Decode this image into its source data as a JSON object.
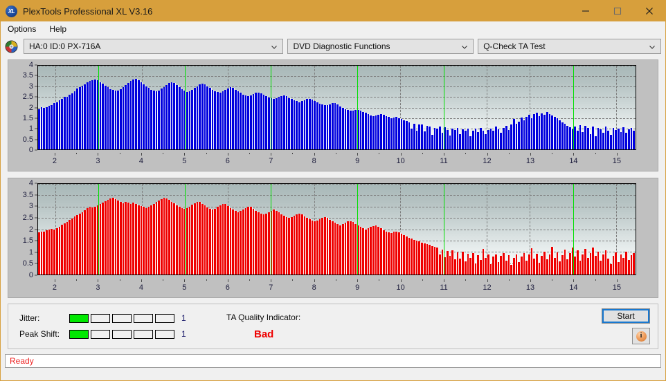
{
  "window": {
    "title": "PlexTools Professional XL V3.16",
    "icon": "xl-app-icon",
    "minimize_label": "minimize-icon",
    "maximize_label": "maximize-icon",
    "close_label": "close-icon"
  },
  "menu": {
    "items": [
      {
        "label": "Options"
      },
      {
        "label": "Help"
      }
    ]
  },
  "toolbar": {
    "drive_icon": "disc-icon",
    "drive_value": "HA:0 ID:0  PX-716A",
    "function_value": "DVD Diagnostic Functions",
    "test_value": "Q-Check TA Test",
    "chevron_icon": "chevron-down-icon"
  },
  "indicators": {
    "jitter": {
      "label": "Jitter:",
      "value": "1",
      "segments_total": 5,
      "segments_on": 1,
      "on_color": "#00e800"
    },
    "peak_shift": {
      "label": "Peak Shift:",
      "value": "1",
      "segments_total": 5,
      "segments_on": 1,
      "on_color": "#00e800"
    },
    "ta_quality": {
      "label": "TA Quality Indicator:",
      "value": "Bad",
      "value_color": "#ee0000"
    }
  },
  "actions": {
    "start_label": "Start",
    "info_label": "i",
    "info_icon": "info-icon"
  },
  "status": {
    "text": "Ready",
    "color": "#ee2222"
  },
  "chart_data": [
    {
      "id": "ta-jitter-chart",
      "type": "bar",
      "title": "",
      "xlabel": "",
      "ylabel": "",
      "bar_color": "#0000dd",
      "ylim": [
        0,
        4
      ],
      "yticks": [
        0,
        0.5,
        1,
        1.5,
        2,
        2.5,
        3,
        3.5,
        4
      ],
      "ytick_labels": [
        "0",
        "0.5",
        "1",
        "1.5",
        "2",
        "2.5",
        "3",
        "3.5",
        "4"
      ],
      "xlim": [
        1.6,
        15.45
      ],
      "xticks": [
        2,
        3,
        4,
        5,
        6,
        7,
        8,
        9,
        10,
        11,
        12,
        13,
        14,
        15
      ],
      "xtick_labels": [
        "2",
        "3",
        "4",
        "5",
        "6",
        "7",
        "8",
        "9",
        "10",
        "11",
        "12",
        "13",
        "14",
        "15"
      ],
      "grid": true,
      "markers": [
        3,
        5,
        7,
        9,
        11,
        14
      ],
      "marker_color": "#00e000",
      "values": [
        1.92,
        2.02,
        2.0,
        2.02,
        2.08,
        2.12,
        2.2,
        2.26,
        2.34,
        2.42,
        2.5,
        2.52,
        2.6,
        2.68,
        2.78,
        2.9,
        2.98,
        3.04,
        3.12,
        3.2,
        3.26,
        3.3,
        3.34,
        3.3,
        3.22,
        3.14,
        3.04,
        2.96,
        2.88,
        2.84,
        2.8,
        2.82,
        2.88,
        2.96,
        3.06,
        3.16,
        3.26,
        3.34,
        3.36,
        3.3,
        3.22,
        3.12,
        3.02,
        2.94,
        2.86,
        2.8,
        2.78,
        2.82,
        2.9,
        2.98,
        3.08,
        3.16,
        3.2,
        3.16,
        3.08,
        2.98,
        2.88,
        2.8,
        2.76,
        2.78,
        2.86,
        2.94,
        3.02,
        3.1,
        3.14,
        3.1,
        3.02,
        2.94,
        2.86,
        2.78,
        2.74,
        2.72,
        2.78,
        2.86,
        2.92,
        2.98,
        2.94,
        2.86,
        2.78,
        2.7,
        2.62,
        2.58,
        2.54,
        2.58,
        2.64,
        2.7,
        2.72,
        2.68,
        2.62,
        2.54,
        2.48,
        2.44,
        2.4,
        2.44,
        2.5,
        2.56,
        2.58,
        2.54,
        2.46,
        2.4,
        2.34,
        2.3,
        2.26,
        2.3,
        2.36,
        2.4,
        2.42,
        2.38,
        2.32,
        2.24,
        2.18,
        2.14,
        2.1,
        2.12,
        2.16,
        2.2,
        2.2,
        2.14,
        2.06,
        1.98,
        1.92,
        1.88,
        1.84,
        1.86,
        1.9,
        1.9,
        1.86,
        1.8,
        1.74,
        1.68,
        1.62,
        1.58,
        1.62,
        1.66,
        1.7,
        1.66,
        1.6,
        1.54,
        1.5,
        1.52,
        1.54,
        1.5,
        1.46,
        1.4,
        1.34,
        1.3,
        0.98,
        1.24,
        0.9,
        1.18,
        1.2,
        0.86,
        1.12,
        1.08,
        0.7,
        1.04,
        0.98,
        1.1,
        0.78,
        1.06,
        0.94,
        0.66,
        1.0,
        0.92,
        1.04,
        0.74,
        0.96,
        0.88,
        1.0,
        0.62,
        0.9,
        0.98,
        0.84,
        1.02,
        0.9,
        0.72,
        0.94,
        1.0,
        0.88,
        1.08,
        0.96,
        0.8,
        1.02,
        1.12,
        0.94,
        1.2,
        1.46,
        1.24,
        1.32,
        1.52,
        1.38,
        1.56,
        1.64,
        1.5,
        1.68,
        1.74,
        1.6,
        1.72,
        1.66,
        1.78,
        1.7,
        1.62,
        1.56,
        1.48,
        1.4,
        1.3,
        1.24,
        1.12,
        1.06,
        0.96,
        1.1,
        0.9,
        1.16,
        0.82,
        1.12,
        1.04,
        0.72,
        1.08,
        0.62,
        1.02,
        0.96,
        0.8,
        1.1,
        0.88,
        0.7,
        1.04,
        0.92,
        1.0,
        0.84,
        1.06,
        0.78,
        0.96,
        1.02,
        0.9
      ]
    },
    {
      "id": "ta-peak-shift-chart",
      "type": "bar",
      "title": "",
      "xlabel": "",
      "ylabel": "",
      "bar_color": "#ee0000",
      "ylim": [
        0,
        4
      ],
      "yticks": [
        0,
        0.5,
        1,
        1.5,
        2,
        2.5,
        3,
        3.5,
        4
      ],
      "ytick_labels": [
        "0",
        "0.5",
        "1",
        "1.5",
        "2",
        "2.5",
        "3",
        "3.5",
        "4"
      ],
      "xlim": [
        1.6,
        15.45
      ],
      "xticks": [
        2,
        3,
        4,
        5,
        6,
        7,
        8,
        9,
        10,
        11,
        12,
        13,
        14,
        15
      ],
      "xtick_labels": [
        "2",
        "3",
        "4",
        "5",
        "6",
        "7",
        "8",
        "9",
        "10",
        "11",
        "12",
        "13",
        "14",
        "15"
      ],
      "grid": true,
      "markers": [
        3,
        5,
        7,
        9,
        11,
        14
      ],
      "marker_color": "#00e000",
      "values": [
        1.86,
        1.9,
        1.88,
        1.94,
        2.0,
        2.02,
        2.0,
        2.06,
        2.12,
        2.2,
        2.26,
        2.32,
        2.4,
        2.48,
        2.56,
        2.62,
        2.68,
        2.76,
        2.84,
        2.92,
        2.98,
        2.96,
        3.0,
        3.06,
        3.12,
        3.18,
        3.24,
        3.3,
        3.36,
        3.38,
        3.32,
        3.26,
        3.2,
        3.16,
        3.2,
        3.18,
        3.1,
        3.18,
        3.12,
        3.06,
        3.02,
        2.98,
        2.94,
        2.98,
        3.04,
        3.12,
        3.2,
        3.28,
        3.34,
        3.4,
        3.36,
        3.3,
        3.22,
        3.14,
        3.06,
        3.0,
        2.94,
        2.9,
        2.94,
        3.0,
        3.08,
        3.16,
        3.22,
        3.2,
        3.12,
        3.04,
        2.96,
        2.9,
        2.86,
        2.9,
        2.98,
        3.06,
        3.12,
        3.1,
        3.02,
        2.94,
        2.86,
        2.8,
        2.76,
        2.8,
        2.86,
        2.94,
        3.0,
        2.98,
        2.9,
        2.82,
        2.76,
        2.7,
        2.66,
        2.7,
        2.76,
        2.82,
        2.86,
        2.82,
        2.74,
        2.66,
        2.6,
        2.54,
        2.5,
        2.54,
        2.6,
        2.66,
        2.7,
        2.66,
        2.58,
        2.5,
        2.44,
        2.38,
        2.34,
        2.38,
        2.44,
        2.5,
        2.54,
        2.5,
        2.42,
        2.34,
        2.28,
        2.22,
        2.18,
        2.22,
        2.28,
        2.34,
        2.36,
        2.32,
        2.24,
        2.16,
        2.1,
        2.04,
        2.0,
        2.04,
        2.1,
        2.14,
        2.16,
        2.12,
        2.04,
        1.96,
        1.9,
        1.86,
        1.84,
        1.88,
        1.9,
        1.86,
        1.8,
        1.74,
        1.68,
        1.62,
        1.58,
        1.54,
        1.5,
        1.46,
        1.42,
        1.38,
        1.34,
        1.3,
        1.26,
        1.22,
        1.18,
        0.9,
        1.1,
        0.76,
        1.04,
        0.82,
        1.08,
        0.66,
        0.98,
        0.7,
        1.02,
        0.58,
        0.92,
        0.74,
        0.96,
        0.5,
        0.86,
        0.64,
        1.12,
        0.72,
        0.9,
        0.46,
        0.78,
        0.88,
        0.54,
        0.82,
        0.96,
        0.6,
        0.86,
        0.44,
        0.74,
        0.9,
        0.56,
        0.8,
        0.94,
        0.62,
        0.88,
        1.16,
        0.7,
        0.92,
        0.52,
        0.84,
        1.02,
        0.66,
        0.9,
        1.22,
        0.74,
        0.98,
        0.58,
        0.86,
        1.1,
        0.68,
        0.94,
        1.18,
        0.8,
        1.06,
        0.62,
        0.9,
        1.14,
        0.72,
        0.96,
        1.2,
        0.84,
        1.02,
        0.6,
        0.88,
        1.08,
        0.7,
        0.46,
        0.82,
        0.98,
        0.56,
        0.9,
        0.74,
        1.0,
        0.64,
        0.86,
        0.94
      ]
    }
  ]
}
